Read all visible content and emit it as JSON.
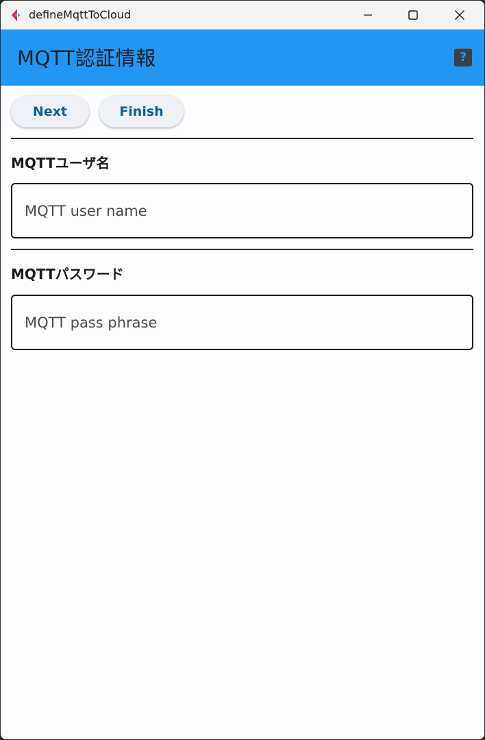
{
  "window": {
    "title": "defineMqttToCloud"
  },
  "appbar": {
    "title": "MQTT認証情報",
    "help_glyph": "?",
    "color": "#2196f3"
  },
  "buttons": {
    "next_label": "Next",
    "finish_label": "Finish"
  },
  "fields": {
    "user": {
      "label": "MQTTユーザ名",
      "placeholder": "MQTT user name",
      "value": ""
    },
    "password": {
      "label": "MQTTパスワード",
      "placeholder": "MQTT pass phrase",
      "value": ""
    }
  },
  "icons": {
    "app": "flutter-app-icon",
    "minimize": "minimize-icon",
    "maximize": "maximize-icon",
    "close": "close-icon",
    "help": "help-icon"
  }
}
